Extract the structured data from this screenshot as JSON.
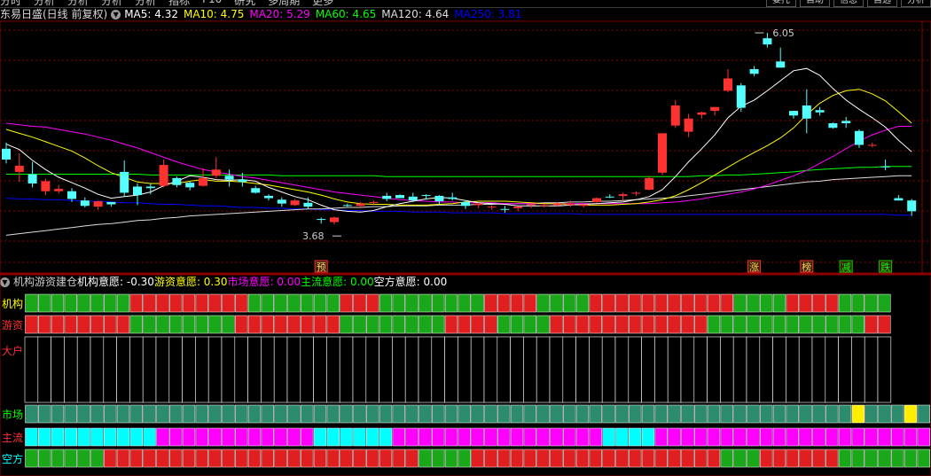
{
  "menu": {
    "items": [
      "分时",
      "分析",
      "分析",
      "分析",
      "分析",
      "指标",
      "F10",
      "研究",
      "多周期",
      "更多"
    ],
    "right": [
      "委托",
      "自助",
      "信息",
      "自选",
      "分析"
    ]
  },
  "main_title": "东易日盛(日线 前复权)",
  "ma_legend": [
    {
      "label": "MA5: 4.32",
      "color": "#ffffff"
    },
    {
      "label": "MA10: 4.75",
      "color": "#ffff00"
    },
    {
      "label": "MA20: 5.29",
      "color": "#ff00ff"
    },
    {
      "label": "MA60: 4.65",
      "color": "#00ff00"
    },
    {
      "label": "MA120: 4.64",
      "color": "#dddddd"
    },
    {
      "label": "MA250: 3.81",
      "color": "#0000ff"
    }
  ],
  "indicator_title": "机构游资建仓",
  "indicator_legend": [
    {
      "label": "机构意愿: -0.30",
      "color": "#ffffff"
    },
    {
      "label": "游资意愿: 0.30",
      "color": "#ffff00"
    },
    {
      "label": "市场意愿: 0.00",
      "color": "#ff00ff"
    },
    {
      "label": "主流意愿: 0.00",
      "color": "#00ff00"
    },
    {
      "label": "空方意愿: 0.00",
      "color": "#ffffff"
    }
  ],
  "event_markers": [
    {
      "label": "预",
      "index": 24,
      "color": "#ff3030"
    },
    {
      "label": "涨",
      "index": 57,
      "color": "#ff3030"
    },
    {
      "label": "榜",
      "index": 61,
      "color": "#ff3030"
    },
    {
      "label": "减",
      "index": 64,
      "color": "#00cc00"
    },
    {
      "label": "跌",
      "index": 67,
      "color": "#00cc00"
    }
  ],
  "colors": {
    "up": "#ff3232",
    "down": "#54ffff",
    "ma5": "#ffffff",
    "ma10": "#ffff00",
    "ma20": "#ff00ff",
    "ma60": "#00ff00",
    "ma120": "#dddddd",
    "ma250": "#0000ff",
    "grid": "#8b0000"
  },
  "chart_data": [
    {
      "type": "candlestick",
      "title": "东易日盛(日线 前复权)",
      "ylim": [
        3.4,
        6.2
      ],
      "annotations": [
        {
          "label": "6.05",
          "text": "6.05",
          "kind": "high"
        },
        {
          "label": "3.68",
          "text": "3.68",
          "kind": "low"
        }
      ],
      "ohlc": [
        [
          4.55,
          4.63,
          4.36,
          4.41
        ],
        [
          4.25,
          4.49,
          4.12,
          4.33
        ],
        [
          4.22,
          4.38,
          4.05,
          4.1
        ],
        [
          4.0,
          4.16,
          3.95,
          4.13
        ],
        [
          4.0,
          4.08,
          3.97,
          4.03
        ],
        [
          4.0,
          4.04,
          3.86,
          3.9
        ],
        [
          3.88,
          3.92,
          3.79,
          3.81
        ],
        [
          3.8,
          3.88,
          3.76,
          3.87
        ],
        [
          3.86,
          3.86,
          3.8,
          3.83
        ],
        [
          4.25,
          4.4,
          3.93,
          3.98
        ],
        [
          4.06,
          4.1,
          3.82,
          3.95
        ],
        [
          4.06,
          4.1,
          3.96,
          4.04
        ],
        [
          4.07,
          4.41,
          4.05,
          4.34
        ],
        [
          4.17,
          4.19,
          4.05,
          4.08
        ],
        [
          4.11,
          4.13,
          4.01,
          4.05
        ],
        [
          4.07,
          4.3,
          4.06,
          4.17
        ],
        [
          4.2,
          4.44,
          4.17,
          4.28
        ],
        [
          4.2,
          4.28,
          4.06,
          4.15
        ],
        [
          4.15,
          4.24,
          4.06,
          4.12
        ],
        [
          4.04,
          4.07,
          3.97,
          3.98
        ],
        [
          3.94,
          3.96,
          3.88,
          3.91
        ],
        [
          3.89,
          3.92,
          3.8,
          3.84
        ],
        [
          3.82,
          3.9,
          3.81,
          3.88
        ],
        [
          3.85,
          3.92,
          3.77,
          3.8
        ],
        [
          3.64,
          3.66,
          3.58,
          3.63
        ],
        [
          3.6,
          3.67,
          3.57,
          3.66
        ],
        [
          3.82,
          3.84,
          3.8,
          3.81
        ],
        [
          3.81,
          3.86,
          3.79,
          3.84
        ],
        [
          3.85,
          3.88,
          3.82,
          3.86
        ],
        [
          3.94,
          3.98,
          3.87,
          3.9
        ],
        [
          3.95,
          3.96,
          3.91,
          3.91
        ],
        [
          3.93,
          3.98,
          3.86,
          3.88
        ],
        [
          3.95,
          3.96,
          3.89,
          3.94
        ],
        [
          3.94,
          3.95,
          3.83,
          3.87
        ],
        [
          3.92,
          3.98,
          3.88,
          3.9
        ],
        [
          3.86,
          3.88,
          3.77,
          3.81
        ],
        [
          3.82,
          3.85,
          3.78,
          3.84
        ],
        [
          3.79,
          3.82,
          3.76,
          3.8
        ],
        [
          3.77,
          3.81,
          3.72,
          3.76
        ],
        [
          3.78,
          3.8,
          3.74,
          3.8
        ],
        [
          3.82,
          3.84,
          3.78,
          3.83
        ],
        [
          3.81,
          3.84,
          3.79,
          3.82
        ],
        [
          3.82,
          3.86,
          3.8,
          3.84
        ],
        [
          3.82,
          3.88,
          3.8,
          3.84
        ],
        [
          3.81,
          3.84,
          3.79,
          3.83
        ],
        [
          3.86,
          3.92,
          3.85,
          3.91
        ],
        [
          3.93,
          3.96,
          3.91,
          3.92
        ],
        [
          3.94,
          3.98,
          3.88,
          3.96
        ],
        [
          3.97,
          4.0,
          3.94,
          3.98
        ],
        [
          4.02,
          4.2,
          4.01,
          4.17
        ],
        [
          4.24,
          4.75,
          4.21,
          4.75
        ],
        [
          4.85,
          5.18,
          4.82,
          5.11
        ],
        [
          4.77,
          5.0,
          4.7,
          4.94
        ],
        [
          4.99,
          5.03,
          4.94,
          5.02
        ],
        [
          5.04,
          5.09,
          4.98,
          5.09
        ],
        [
          5.3,
          5.58,
          5.28,
          5.46
        ],
        [
          5.37,
          5.4,
          5.03,
          5.08
        ],
        [
          5.58,
          5.62,
          5.49,
          5.52
        ],
        [
          5.98,
          6.05,
          5.86,
          5.9
        ],
        [
          5.68,
          5.86,
          5.6,
          5.6
        ],
        [
          5.04,
          5.04,
          4.94,
          4.98
        ],
        [
          5.11,
          5.32,
          4.75,
          4.94
        ],
        [
          5.05,
          5.09,
          4.98,
          5.02
        ],
        [
          4.88,
          4.89,
          4.81,
          4.82
        ],
        [
          4.91,
          4.96,
          4.82,
          4.88
        ],
        [
          4.78,
          4.8,
          4.56,
          4.6
        ],
        [
          4.59,
          4.63,
          4.57,
          4.6
        ],
        [
          4.32,
          4.41,
          4.27,
          4.31
        ],
        [
          3.91,
          3.95,
          3.88,
          3.88
        ],
        [
          3.88,
          3.9,
          3.68,
          3.74
        ]
      ],
      "ma5": [
        4.61,
        4.54,
        4.4,
        4.28,
        4.18,
        4.11,
        4.04,
        3.96,
        3.91,
        3.93,
        3.95,
        3.99,
        4.07,
        4.13,
        4.2,
        4.18,
        4.15,
        4.14,
        4.15,
        4.13,
        4.05,
        3.99,
        3.93,
        3.89,
        3.82,
        3.76,
        3.74,
        3.73,
        3.75,
        3.8,
        3.84,
        3.87,
        3.9,
        3.92,
        3.91,
        3.88,
        3.85,
        3.84,
        3.83,
        3.81,
        3.81,
        3.81,
        3.81,
        3.82,
        3.83,
        3.84,
        3.85,
        3.86,
        3.89,
        3.93,
        4.02,
        4.19,
        4.38,
        4.55,
        4.73,
        4.95,
        5.1,
        5.18,
        5.3,
        5.43,
        5.56,
        5.59,
        5.5,
        5.33,
        5.18,
        5.06,
        4.95,
        4.83,
        4.66,
        4.51
      ],
      "ma10": [
        4.8,
        4.75,
        4.7,
        4.64,
        4.58,
        4.52,
        4.43,
        4.33,
        4.24,
        4.18,
        4.12,
        4.1,
        4.1,
        4.1,
        4.13,
        4.15,
        4.13,
        4.13,
        4.12,
        4.1,
        4.08,
        4.05,
        4.02,
        3.99,
        3.95,
        3.9,
        3.86,
        3.84,
        3.83,
        3.83,
        3.82,
        3.82,
        3.82,
        3.83,
        3.84,
        3.86,
        3.87,
        3.87,
        3.87,
        3.86,
        3.85,
        3.84,
        3.84,
        3.83,
        3.82,
        3.82,
        3.82,
        3.83,
        3.84,
        3.86,
        3.89,
        3.94,
        4.02,
        4.11,
        4.21,
        4.31,
        4.41,
        4.5,
        4.59,
        4.69,
        4.82,
        4.99,
        5.14,
        5.24,
        5.3,
        5.32,
        5.26,
        5.17,
        5.03,
        4.88
      ],
      "ma20": [
        4.88,
        4.86,
        4.84,
        4.83,
        4.8,
        4.77,
        4.74,
        4.7,
        4.66,
        4.61,
        4.56,
        4.5,
        4.44,
        4.38,
        4.33,
        4.28,
        4.25,
        4.22,
        4.19,
        4.17,
        4.14,
        4.11,
        4.08,
        4.05,
        4.02,
        3.99,
        3.97,
        3.95,
        3.93,
        3.91,
        3.89,
        3.88,
        3.87,
        3.86,
        3.86,
        3.85,
        3.85,
        3.85,
        3.84,
        3.84,
        3.84,
        3.84,
        3.84,
        3.84,
        3.84,
        3.84,
        3.84,
        3.84,
        3.84,
        3.84,
        3.85,
        3.86,
        3.88,
        3.9,
        3.93,
        3.96,
        3.99,
        4.03,
        4.08,
        4.14,
        4.2,
        4.27,
        4.36,
        4.45,
        4.55,
        4.65,
        4.73,
        4.79,
        4.84,
        4.84
      ],
      "ma60": [
        4.22,
        4.22,
        4.22,
        4.22,
        4.22,
        4.22,
        4.22,
        4.22,
        4.22,
        4.22,
        4.22,
        4.21,
        4.21,
        4.21,
        4.21,
        4.21,
        4.21,
        4.21,
        4.21,
        4.21,
        4.21,
        4.2,
        4.2,
        4.2,
        4.2,
        4.2,
        4.2,
        4.2,
        4.2,
        4.19,
        4.19,
        4.19,
        4.19,
        4.19,
        4.19,
        4.19,
        4.19,
        4.19,
        4.19,
        4.19,
        4.19,
        4.19,
        4.19,
        4.19,
        4.19,
        4.19,
        4.19,
        4.19,
        4.19,
        4.19,
        4.19,
        4.19,
        4.19,
        4.2,
        4.2,
        4.21,
        4.21,
        4.22,
        4.23,
        4.24,
        4.25,
        4.27,
        4.28,
        4.29,
        4.3,
        4.31,
        4.31,
        4.32,
        4.32,
        4.32
      ],
      "ma120": [
        3.43,
        3.45,
        3.47,
        3.49,
        3.51,
        3.53,
        3.55,
        3.57,
        3.58,
        3.6,
        3.62,
        3.63,
        3.65,
        3.66,
        3.68,
        3.69,
        3.7,
        3.71,
        3.72,
        3.73,
        3.74,
        3.75,
        3.76,
        3.77,
        3.77,
        3.78,
        3.79,
        3.79,
        3.8,
        3.8,
        3.81,
        3.81,
        3.81,
        3.82,
        3.82,
        3.82,
        3.83,
        3.83,
        3.84,
        3.84,
        3.84,
        3.85,
        3.85,
        3.86,
        3.86,
        3.87,
        3.87,
        3.88,
        3.89,
        3.9,
        3.91,
        3.92,
        3.94,
        3.96,
        3.98,
        4.0,
        4.02,
        4.04,
        4.06,
        4.08,
        4.1,
        4.12,
        4.13,
        4.15,
        4.16,
        4.17,
        4.18,
        4.19,
        4.2,
        4.2
      ],
      "ma250": [
        3.91,
        3.9,
        3.9,
        3.89,
        3.89,
        3.88,
        3.87,
        3.87,
        3.86,
        3.85,
        3.85,
        3.84,
        3.83,
        3.83,
        3.82,
        3.81,
        3.81,
        3.8,
        3.79,
        3.79,
        3.78,
        3.78,
        3.77,
        3.77,
        3.76,
        3.76,
        3.75,
        3.75,
        3.74,
        3.74,
        3.74,
        3.73,
        3.73,
        3.73,
        3.72,
        3.72,
        3.72,
        3.72,
        3.71,
        3.71,
        3.71,
        3.71,
        3.71,
        3.71,
        3.7,
        3.7,
        3.7,
        3.7,
        3.7,
        3.7,
        3.7,
        3.7,
        3.7,
        3.7,
        3.7,
        3.7,
        3.7,
        3.7,
        3.7,
        3.7,
        3.7,
        3.7,
        3.7,
        3.7,
        3.7,
        3.7,
        3.7,
        3.7,
        3.69,
        3.69
      ]
    },
    {
      "type": "heatmap",
      "title": "机构游资建仓",
      "rows": [
        {
          "label": "机构",
          "color": "#ffff00",
          "cells": "GGGGGGGGRRRRRRRRRGGGGGGGRRRGGGGGGGGRRRRGGGGRRRRRRRRRRRGGGGRRRRGGGG"
        },
        {
          "label": "游资",
          "color": "#ff3030",
          "cells": "RRRRRRRRGGGGGGGGRRRRRRRRGGGGGGGGRRRRGGGGRRRRRRRRRRRRGGGGGGGGGGGGRR"
        },
        {
          "label": "大户",
          "color": "#ff3030",
          "cells": "EEEEEEEEEEEEEEEEEEEEEEEEEEEEEEEEEEEEEEEEEEEEEEEEEEEEEEEEEEEEEEEEEE"
        },
        {
          "label": "市场",
          "color": "#00ff00",
          "cells": "TTTTTTTTTTTTTTTTTTTTTTTTTTTTTTTTTTTTTTTTTTTTTTTTTTTTTTTTTTTTTTTYTTTYTT"
        },
        {
          "label": "主流",
          "color": "#ff3030",
          "cells": "CCCCCCCCCCMMMMMMMMMMMMCCCCCCMMMMMMMMMMMMMMMMCCCCMMMMMMMMMMMMMMMMMMMMMMCCCCCCCCCC"
        },
        {
          "label": "空方",
          "color": "#00ffff",
          "cells": "GGGGGGRRRRRRRRRRRRRRRRRRRRRRRRGGGGRRRRRRRRRRRRRRRRRRRGGGRRRRRRGGGGGGGGGGG"
        }
      ]
    }
  ]
}
